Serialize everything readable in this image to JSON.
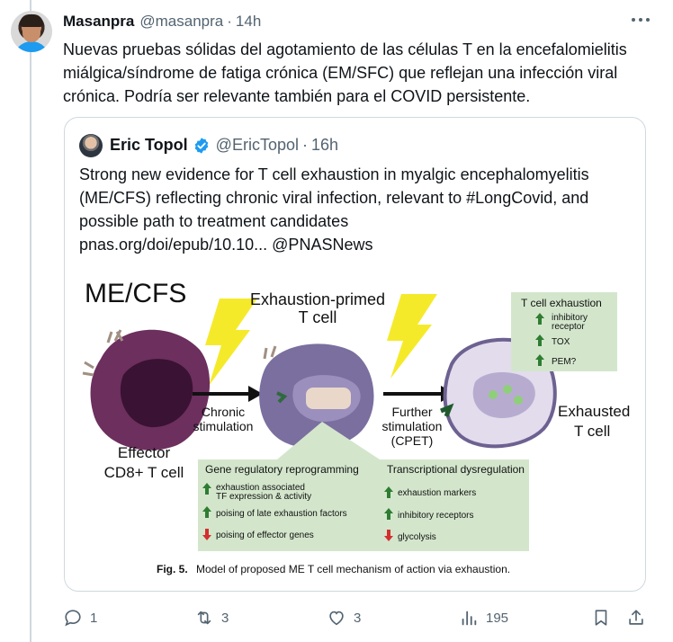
{
  "post": {
    "author_name": "Masanpra",
    "author_handle": "@masanpra",
    "separator": "·",
    "time": "14h",
    "text": "Nuevas pruebas sólidas del agotamiento de las células T en la encefalomielitis miálgica/síndrome de fatiga crónica (EM/SFC) que reflejan una infección viral crónica. Podría ser relevante también para el COVID persistente."
  },
  "quote": {
    "author_name": "Eric Topol",
    "author_handle": "@EricTopol",
    "separator": "·",
    "time": "16h",
    "text": "Strong new evidence for T cell exhaustion in myalgic encephalomyelitis (ME/CFS) reflecting chronic viral infection, relevant to #LongCovid, and possible path to treatment candidates",
    "link_line": "pnas.org/doi/epub/10.10... @PNASNews"
  },
  "figure": {
    "title": "ME/CFS",
    "primed_label_1": "Exhaustion-primed",
    "primed_label_2": "T cell",
    "effector_label_1": "Effector",
    "effector_label_2": "CD8+ T cell",
    "arrow1_label_1": "Chronic",
    "arrow1_label_2": "stimulation",
    "arrow2_label_1": "Further",
    "arrow2_label_2": "stimulation",
    "arrow2_label_3": "(CPET)",
    "exhausted_label_1": "Exhausted",
    "exhausted_label_2": "T cell",
    "exhaustion_box": {
      "title": "T cell exhaustion",
      "items": [
        "inhibitory",
        "receptor",
        "TOX",
        "PEM?"
      ]
    },
    "gene_box": {
      "title": "Gene regulatory reprogramming",
      "item1_line1": "exhaustion associated",
      "item1_line2": "TF expression & activity",
      "item2": "poising of late exhaustion factors",
      "item3": "poising of effector genes"
    },
    "tx_box": {
      "title": "Transcriptional dysregulation",
      "item1": "exhaustion markers",
      "item2": "inhibitory receptors",
      "item3": "glycolysis"
    },
    "caption_label": "Fig. 5.",
    "caption_text": "Model of proposed ME T cell mechanism of action via exhaustion."
  },
  "actions": {
    "replies": "1",
    "reposts": "3",
    "likes": "3",
    "views": "195"
  },
  "colors": {
    "verified": "#1d9bf0",
    "secondary_text": "#536471",
    "bolt": "#f5ea2a",
    "green_box": "#d3e6cc",
    "up_arrow": "#2e7d32",
    "down_arrow": "#d32f2f"
  }
}
